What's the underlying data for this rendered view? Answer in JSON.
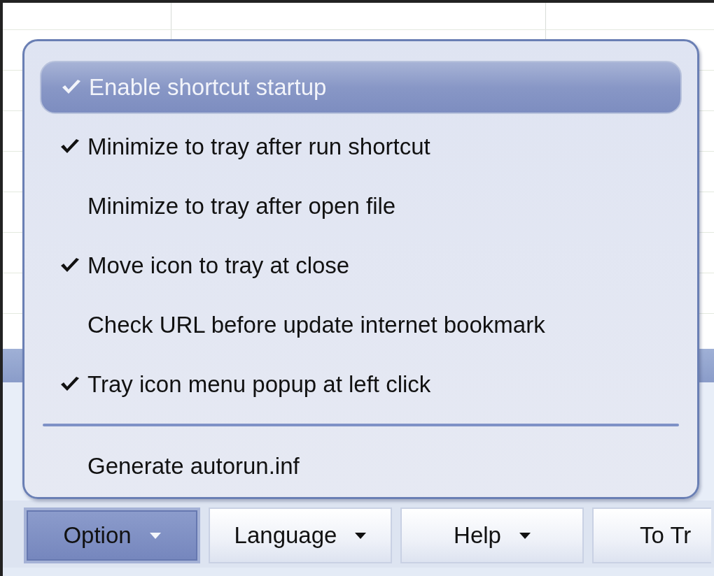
{
  "menu": {
    "items": [
      {
        "kind": "item",
        "label": "Enable shortcut startup",
        "checked": true,
        "selected": true
      },
      {
        "kind": "item",
        "label": "Minimize to tray after run shortcut",
        "checked": true,
        "selected": false
      },
      {
        "kind": "item",
        "label": "Minimize to tray after open file",
        "checked": false,
        "selected": false
      },
      {
        "kind": "item",
        "label": "Move icon to tray at close",
        "checked": true,
        "selected": false
      },
      {
        "kind": "item",
        "label": "Check URL before update internet bookmark",
        "checked": false,
        "selected": false
      },
      {
        "kind": "item",
        "label": "Tray icon menu popup at left click",
        "checked": true,
        "selected": false
      },
      {
        "kind": "separator"
      },
      {
        "kind": "item",
        "label": "Generate autorun.inf",
        "checked": false,
        "selected": false
      }
    ]
  },
  "toolbar": {
    "buttons": [
      {
        "label": "Option",
        "selected": true,
        "caret": true
      },
      {
        "label": "Language",
        "selected": false,
        "caret": true
      },
      {
        "label": "Help",
        "selected": false,
        "caret": true
      },
      {
        "label": "To Tr",
        "selected": false,
        "caret": false
      }
    ]
  }
}
